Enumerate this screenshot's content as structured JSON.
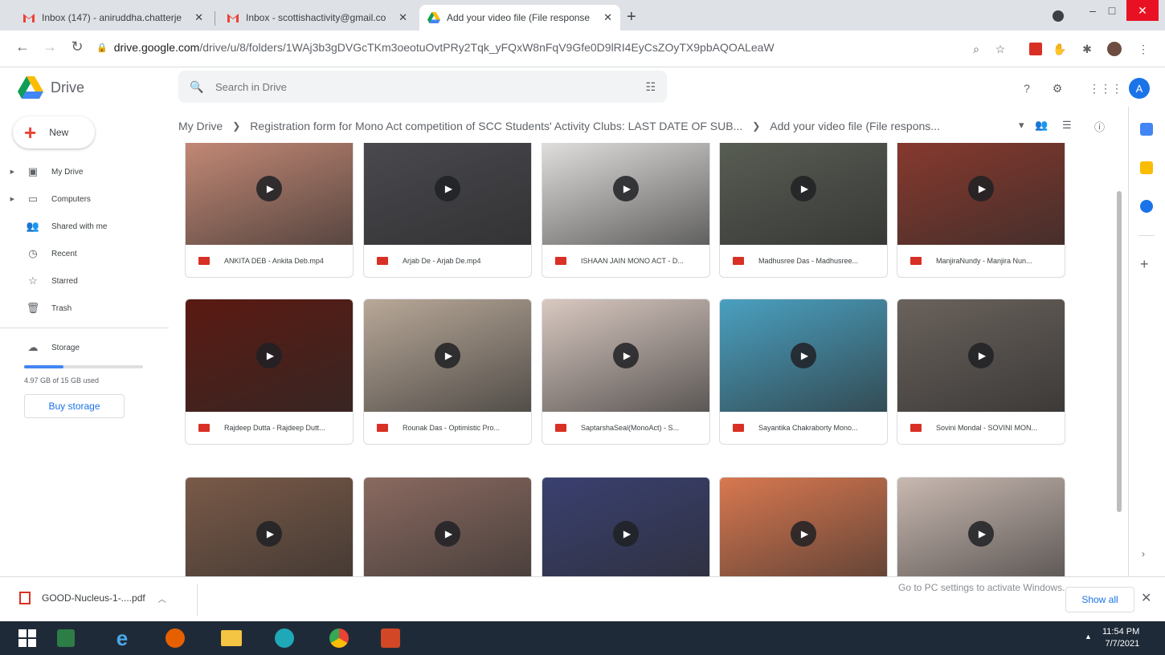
{
  "browser": {
    "tabs": [
      {
        "title": "Inbox (147) - aniruddha.chatterje",
        "icon": "gmail-icon",
        "active": false
      },
      {
        "title": "Inbox - scottishactivity@gmail.co",
        "icon": "gmail-icon",
        "active": false
      },
      {
        "title": "Add your video file (File response",
        "icon": "drive-icon",
        "active": true
      }
    ],
    "url_host": "drive.google.com",
    "url_path": "/drive/u/8/folders/1WAj3b3gDVGcTKm3oeotuOvtPRy2Tqk_yFQxW8nFqV9Gfe0D9lRI4EyCsZOyTX9pbAQOALeaW"
  },
  "drive": {
    "app_name": "Drive",
    "search_placeholder": "Search in Drive",
    "avatar_letter": "A",
    "new_label": "New",
    "nav": [
      {
        "label": "My Drive",
        "icon": "my-drive-icon",
        "glyph": "▣",
        "expandable": true
      },
      {
        "label": "Computers",
        "icon": "computers-icon",
        "glyph": "▭",
        "expandable": true
      },
      {
        "label": "Shared with me",
        "icon": "shared-icon",
        "glyph": "👥",
        "expandable": false
      },
      {
        "label": "Recent",
        "icon": "clock-icon",
        "glyph": "◷",
        "expandable": false
      },
      {
        "label": "Starred",
        "icon": "star-icon",
        "glyph": "☆",
        "expandable": false
      },
      {
        "label": "Trash",
        "icon": "trash-icon",
        "glyph": "🗑",
        "expandable": false
      }
    ],
    "storage_label": "Storage",
    "storage_used": "4.97 GB of 15 GB used",
    "storage_fraction": 0.33,
    "buy_storage": "Buy storage",
    "breadcrumbs": [
      "My Drive",
      "Registration form for Mono Act competition of SCC Students' Activity Clubs: LAST DATE OF SUB...",
      "Add your video file (File respons..."
    ],
    "files": [
      {
        "name": "ANKITA DEB - Ankita Deb.mp4",
        "bg": "#c98c78"
      },
      {
        "name": "Arjab De - Arjab De.mp4",
        "bg": "#4a4a50"
      },
      {
        "name": "ISHAAN JAIN MONO ACT - D...",
        "bg": "#e8e6e4"
      },
      {
        "name": "Madhusree Das - Madhusree...",
        "bg": "#5a5f55"
      },
      {
        "name": "ManjiraNundy - Manjira Nun...",
        "bg": "#8b3a2e"
      },
      {
        "name": "Rajdeep Dutta - Rajdeep Dutt...",
        "bg": "#5b1a12"
      },
      {
        "name": "Rounak Das - Optimistic Pro...",
        "bg": "#b8a898"
      },
      {
        "name": "SaptarshaSeal(MonoAct) - S...",
        "bg": "#d8c8c0"
      },
      {
        "name": "Sayantika Chakraborty Mono...",
        "bg": "#4aa0c0"
      },
      {
        "name": "Sovini Mondal - SOVINI MON...",
        "bg": "#6a625c"
      },
      {
        "name": "",
        "bg": "#7a5a48"
      },
      {
        "name": "",
        "bg": "#8a6a60"
      },
      {
        "name": "",
        "bg": "#3a4070"
      },
      {
        "name": "",
        "bg": "#d87850"
      },
      {
        "name": "",
        "bg": "#c8b8b0"
      }
    ]
  },
  "downloads": {
    "file": "GOOD-Nucleus-1-....pdf",
    "show_all": "Show all",
    "watermark": "Go to PC settings to activate Windows."
  },
  "taskbar": {
    "time": "11:54 PM",
    "date": "7/7/2021"
  }
}
